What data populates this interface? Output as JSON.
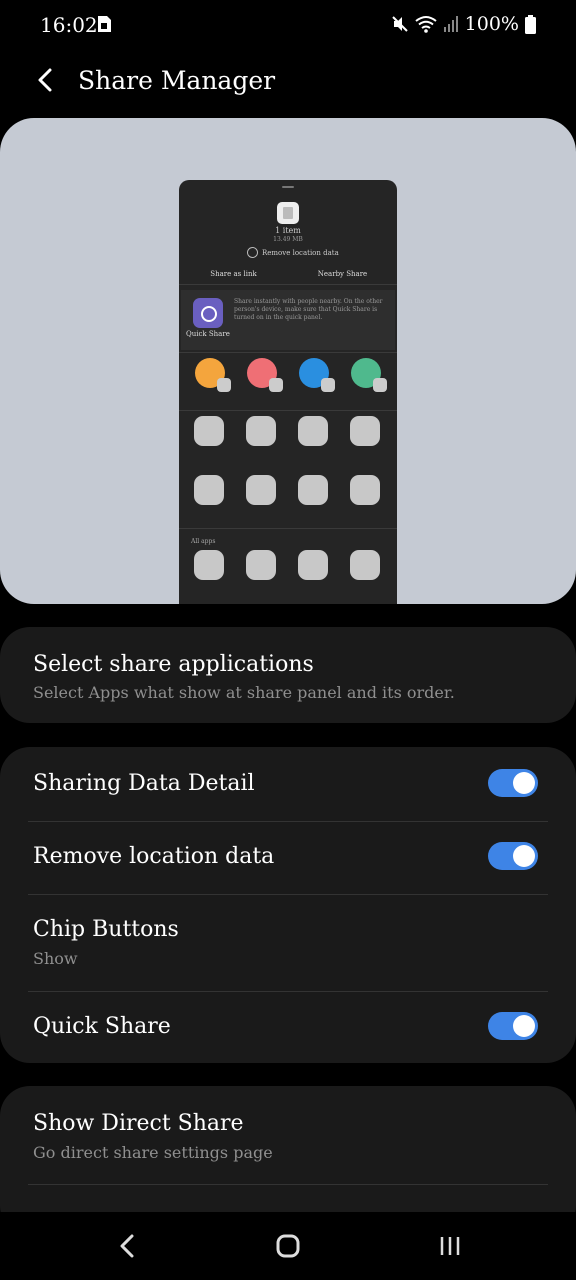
{
  "status_bar": {
    "time": "16:02",
    "battery": "100%",
    "icons": [
      "sim-card-icon",
      "mute-icon",
      "wifi-icon",
      "signal-icon",
      "battery-icon"
    ]
  },
  "app_bar": {
    "title": "Share Manager",
    "back_icon": "back-arrow-icon"
  },
  "preview": {
    "file_count": "1 item",
    "file_size": "13.49 MB",
    "remove_location": "Remove location data",
    "tabs": [
      "Share as link",
      "Nearby Share"
    ],
    "quick_share_label": "Quick Share",
    "quick_share_desc": "Share instantly with people nearby. On the other person's device, make sure that Quick Share is turned on in the quick panel.",
    "all_apps": "All apps",
    "contact_colors": [
      "#f4a53d",
      "#ef6f75",
      "#2a8fe0",
      "#4fb98d"
    ]
  },
  "settings": {
    "select_share": {
      "title": "Select share applications",
      "subtitle": "Select Apps what show at share panel and its order."
    },
    "sharing_data_detail": {
      "title": "Sharing Data Detail",
      "enabled": true
    },
    "remove_location": {
      "title": "Remove location data",
      "enabled": true
    },
    "chip_buttons": {
      "title": "Chip Buttons",
      "subtitle": "Show"
    },
    "quick_share": {
      "title": "Quick Share",
      "enabled": true
    },
    "direct_share": {
      "title": "Show Direct Share",
      "subtitle": "Go direct share settings page"
    }
  },
  "colors": {
    "accent": "#3e84e6",
    "card": "#1a1a1a",
    "preview_bg": "#c5cad3"
  },
  "nav_bar": [
    "back-icon",
    "home-icon",
    "recents-icon"
  ]
}
